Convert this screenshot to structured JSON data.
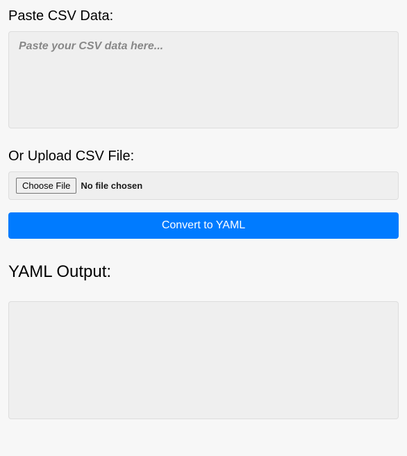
{
  "input": {
    "paste_label": "Paste CSV Data:",
    "textarea_placeholder": "Paste your CSV data here...",
    "textarea_value": "",
    "upload_label": "Or Upload CSV File:",
    "choose_file_button": "Choose File",
    "file_status": "No file chosen"
  },
  "action": {
    "convert_button": "Convert to YAML"
  },
  "output": {
    "heading": "YAML Output:",
    "content": ""
  }
}
